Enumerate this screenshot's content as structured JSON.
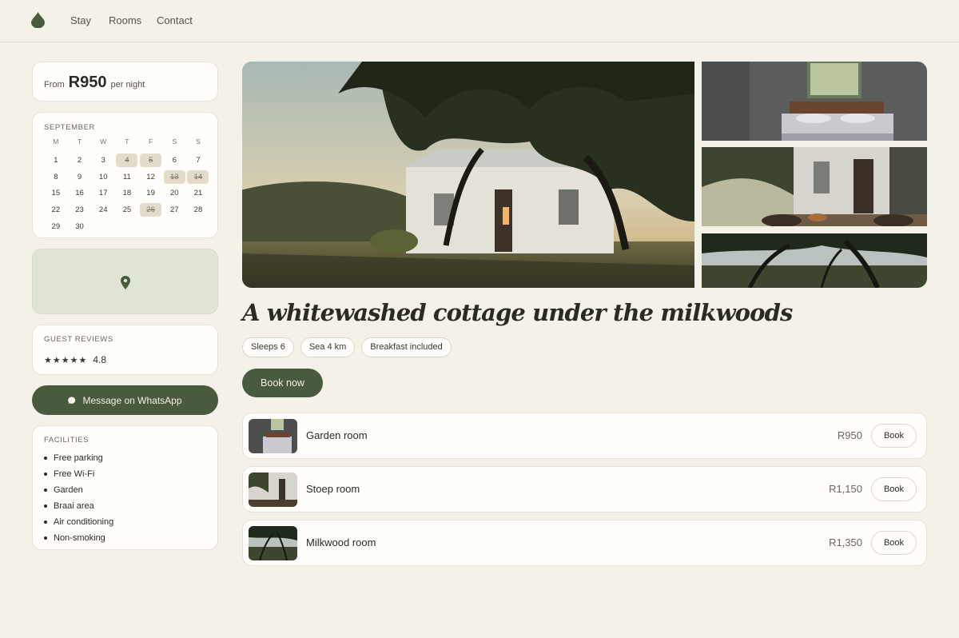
{
  "nav": {
    "logo_icon": "drop-leaf-icon",
    "links": [
      "Stay",
      "Rooms",
      "Contact"
    ]
  },
  "price": {
    "from": "From",
    "amount": "R950",
    "per": "per night"
  },
  "calendar": {
    "month": "SEPTEMBER",
    "weekdays": [
      "M",
      "T",
      "W",
      "T",
      "F",
      "S",
      "S"
    ],
    "days": [
      1,
      2,
      3,
      4,
      5,
      6,
      7,
      8,
      9,
      10,
      11,
      12,
      13,
      14,
      15,
      16,
      17,
      18,
      19,
      20,
      21,
      22,
      23,
      24,
      25,
      26,
      27,
      28,
      29,
      30
    ],
    "booked": [
      4,
      5,
      13,
      14,
      26
    ]
  },
  "map": {
    "icon": "map-pin-icon"
  },
  "reviews": {
    "label": "GUEST REVIEWS",
    "stars": "★★★★★",
    "rating": "4.8"
  },
  "whatsapp": {
    "label": "Message on WhatsApp",
    "icon": "chat-bubble-icon"
  },
  "facilities": {
    "label": "FACILITIES",
    "items": [
      "Free parking",
      "Free Wi-Fi",
      "Garden",
      "Braai area",
      "Air conditioning",
      "Non-smoking"
    ]
  },
  "listing": {
    "title": "A whitewashed cottage under the milkwoods",
    "chips": [
      "Sleeps 6",
      "Sea 4 km",
      "Breakfast included"
    ],
    "book_label": "Book now"
  },
  "rooms": [
    {
      "name": "Garden room",
      "price": "R950",
      "book": "Book"
    },
    {
      "name": "Stoep room",
      "price": "R1,150",
      "book": "Book"
    },
    {
      "name": "Milkwood room",
      "price": "R1,350",
      "book": "Book"
    }
  ],
  "colors": {
    "accent": "#4a5a3e",
    "background": "#f4f1e8",
    "booked": "#e3dccb"
  }
}
